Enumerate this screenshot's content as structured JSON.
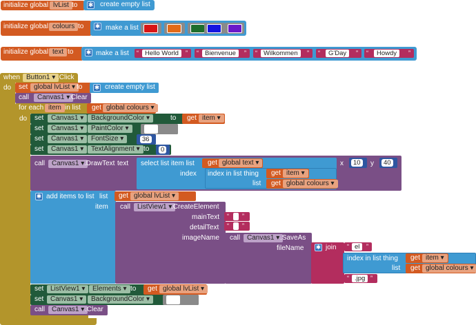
{
  "globals": [
    {
      "init": "initialize global",
      "name": "lvList",
      "to": "to",
      "value_label": "create empty list"
    },
    {
      "init": "initialize global",
      "name": "colours",
      "to": "to",
      "value_label": "make a list",
      "swatches": [
        "#d91515",
        "#e36a17",
        "#1d6e2b",
        "#1414e0",
        "#6a18c9"
      ]
    },
    {
      "init": "initialize global",
      "name": "text",
      "to": "to",
      "value_label": "make a list",
      "strings": [
        "Hello World",
        "Bienvenue",
        "Wilkommen",
        "G'Day",
        "Howdy"
      ]
    }
  ],
  "event": {
    "when": "when",
    "component": "Button1",
    "event": "Click",
    "do": "do",
    "set_kw": "set",
    "call_kw": "call",
    "get_kw": "get",
    "to_kw": "to",
    "global_lvList": "global lvList",
    "create_empty_list": "create empty list",
    "canvas": "Canvas1",
    "clear": "Clear",
    "for_each": "for each",
    "item": "item",
    "in_list": "in list",
    "global_colours": "global colours",
    "background_color": "BackgroundColor",
    "paint_color": "PaintColor",
    "font_size": "FontSize",
    "font_size_value": "36",
    "text_alignment": "TextAlignment",
    "text_alignment_value": "0",
    "draw_text": "DrawText",
    "text_kw": "text",
    "select_list_item": "select list item  list",
    "global_text": "global text",
    "index_kw": "index",
    "index_in_list": "index in list  thing",
    "list_kw": "list",
    "x_kw": "x",
    "x_value": "10",
    "y_kw": "y",
    "y_value": "40",
    "add_items": "add items to list",
    "list_label": "list",
    "item_label": "item",
    "listview": "ListView1",
    "create_element": "CreateElement",
    "main_text": "mainText",
    "detail_text": "detailText",
    "image_name": "imageName",
    "save_as": "SaveAs",
    "file_name": "fileName",
    "join": "join",
    "el": "el",
    "jpg": ".jpg",
    "elements": "Elements"
  },
  "colors": {
    "variable": "#d35a21",
    "list": "#3f9ad2",
    "control": "#b3952b",
    "component": "#7a4f86",
    "component_dark": "#215a3a",
    "text": "#b32d5e",
    "math": "#2e56a1",
    "event": "#b3952b"
  }
}
